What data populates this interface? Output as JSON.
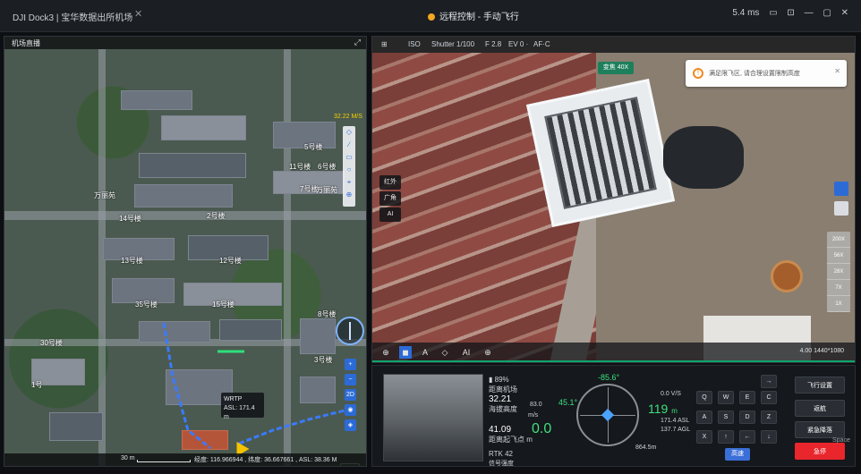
{
  "titlebar": {
    "app_title": "DJI Dock3 | 宝华数据出所机场",
    "close_glyph": "✕",
    "center_title": "远程控制 - 手动飞行",
    "right_info": [
      "5.4 ms",
      "▭",
      "⊡",
      "—",
      "▢",
      "✕"
    ]
  },
  "map": {
    "title": "机场直播",
    "expand_glyph": "⤢",
    "altitude_tag": "32.22 M/S",
    "building_labels": [
      "5号楼",
      "11号楼",
      "6号楼",
      "7号楼",
      "万丽苑",
      "万丽苑",
      "14号楼",
      "2号楼",
      "13号楼",
      "12号楼",
      "35号楼",
      "15号楼",
      "8号楼",
      "30号楼",
      "1号",
      "3号楼"
    ],
    "toolbar_items": [
      "◇",
      "∕",
      "▭",
      "○",
      "⌖",
      "⊕"
    ],
    "side_buttons": [
      "+",
      "−",
      "2D",
      "◉",
      "◈"
    ],
    "popup": {
      "line1": "WRTP",
      "line2": "ASL: 171.4 m"
    },
    "scale_label": "30 m",
    "coords": "经度: 116.966944 , 纬度: 36.667661 , ASL: 38.36 M"
  },
  "video": {
    "head_items": [
      "⊞",
      "ISO",
      "Shutter 1/100",
      "F 2.8",
      "EV 0 ·",
      "AF·C"
    ],
    "zoom_badge": "变焦 40X",
    "toast": {
      "icon": "!",
      "message": "满足限飞区, 请合理设置限制高度",
      "close": "✕"
    },
    "left_tags": [
      "红外",
      "广角",
      "AI"
    ],
    "zoom_scale": [
      "200X",
      "56X",
      "28X",
      "7X",
      "1X"
    ],
    "bottom_buttons": [
      "⊕",
      "◼",
      "A",
      "◇",
      "AI",
      "⊕"
    ],
    "bottom_right": "4.00 1440*1080"
  },
  "control": {
    "battery": "89%",
    "telemetry": [
      {
        "label": "距离机场",
        "value": ""
      },
      {
        "label": "",
        "value": "32.21"
      },
      {
        "label": "海拔高度",
        "value": ""
      },
      {
        "label": "",
        "value": "41.09"
      },
      {
        "label": "距离起飞点 m",
        "value": ""
      }
    ],
    "h_speed_unit": "m/s",
    "h_speed": "0.0",
    "v_speed": "83.0",
    "attitude": "45.1°",
    "heading": "-85.6°",
    "altitude_value": "119",
    "altitude_unit": "m",
    "alt_lines": [
      "0.0 V/S",
      "171.4 ASL",
      "137.7 AGL"
    ],
    "distance": "864.5m",
    "rtk": "RTK 42",
    "rtk_sub": "信号强度",
    "keys": [
      "Q",
      "W",
      "E",
      "C",
      "A",
      "S",
      "D",
      "Z",
      "X",
      "↑",
      "←",
      "↓",
      "→"
    ],
    "mode_button": "高速",
    "actions": [
      "飞行设置",
      "返航",
      "紧急降落",
      "急停"
    ],
    "actions_sub": "Space"
  }
}
